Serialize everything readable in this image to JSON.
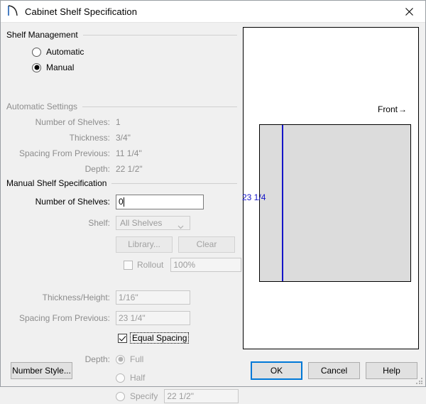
{
  "window": {
    "title": "Cabinet Shelf Specification",
    "icon": "cabinet-door-swing-icon",
    "close_label": "✕"
  },
  "shelf_management": {
    "group_title": "Shelf Management",
    "options": [
      {
        "label": "Automatic",
        "selected": false
      },
      {
        "label": "Manual",
        "selected": true
      }
    ]
  },
  "automatic_settings": {
    "group_title": "Automatic Settings",
    "rows": [
      {
        "label": "Number of Shelves:",
        "value": "1"
      },
      {
        "label": "Thickness:",
        "value": "3/4\""
      },
      {
        "label": "Spacing From Previous:",
        "value": "11 1/4\""
      },
      {
        "label": "Depth:",
        "value": "22 1/2\""
      }
    ]
  },
  "manual_shelf": {
    "group_title": "Manual Shelf Specification",
    "number_of_shelves": {
      "label": "Number of Shelves:",
      "value": "0"
    },
    "shelf": {
      "label": "Shelf:",
      "value": "All Shelves",
      "enabled": false
    },
    "library_button": "Library...",
    "clear_button": "Clear",
    "rollout": {
      "label": "Rollout",
      "checked": false,
      "value": "100%"
    },
    "thickness_height": {
      "label": "Thickness/Height:",
      "value": "1/16\""
    },
    "spacing_from_previous": {
      "label": "Spacing From Previous:",
      "value": "23 1/4\""
    },
    "equal_spacing": {
      "label": "Equal Spacing",
      "checked": true,
      "focused": true
    },
    "depth": {
      "label": "Depth:",
      "options": [
        {
          "label": "Full",
          "selected": true
        },
        {
          "label": "Half",
          "selected": false
        },
        {
          "label": "Specify",
          "selected": false
        }
      ],
      "specify_value": "22 1/2\""
    }
  },
  "preview": {
    "front_label": "Front",
    "front_arrow": "→",
    "dimension_label": "23 1/4",
    "shelf_color": "#dcdcdc",
    "line_color": "#1414c8"
  },
  "footer": {
    "number_style": "Number Style...",
    "ok": "OK",
    "cancel": "Cancel",
    "help": "Help"
  }
}
